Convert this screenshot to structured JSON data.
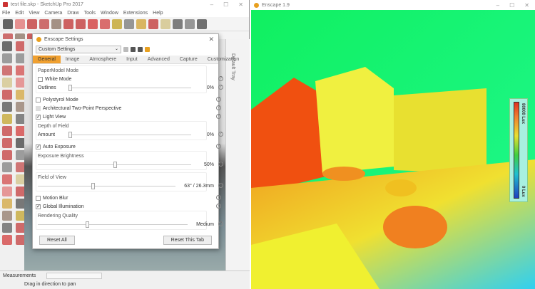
{
  "sketchup": {
    "title": "test file.skp - SketchUp Pro 2017",
    "menu": [
      "File",
      "Edit",
      "View",
      "Camera",
      "Draw",
      "Tools",
      "Window",
      "Extensions",
      "Help"
    ],
    "tray_label": "Default Tray",
    "status": {
      "measurements_label": "Measurements",
      "hint": "Drag in direction to pan"
    }
  },
  "dialog": {
    "title": "Enscape Settings",
    "preset": "Custom Settings",
    "tabs": [
      "General",
      "Image",
      "Atmosphere",
      "Input",
      "Advanced",
      "Capture",
      "Customization"
    ],
    "active_tab": "General",
    "papermodel": {
      "label": "PaperModel Mode",
      "white_mode": "White Mode",
      "white_mode_checked": false,
      "outlines_label": "Outlines",
      "outlines_value": "0%",
      "outlines_fraction": 0
    },
    "polystyrol": "Polystyrol Mode",
    "polystyrol_checked": false,
    "two_point": "Architectural Two-Point Perspective",
    "two_point_checked": false,
    "light_view": "Light View",
    "light_view_checked": true,
    "dof": {
      "label": "Depth of Field",
      "amount_label": "Amount",
      "amount_value": "0%",
      "amount_fraction": 0
    },
    "auto_exposure": "Auto Exposure",
    "auto_exposure_checked": true,
    "exposure": {
      "label": "Exposure Brightness",
      "value": "50%",
      "fraction": 0.5
    },
    "fov": {
      "label": "Field of View",
      "value": "63° / 26.3mm",
      "fraction": 0.4
    },
    "motion_blur": "Motion Blur",
    "motion_blur_checked": false,
    "gi": "Global Illumination",
    "gi_checked": true,
    "quality": {
      "label": "Rendering Quality",
      "value": "Medium",
      "fraction": 0.33
    },
    "reset_all": "Reset All",
    "reset_tab": "Reset This Tab"
  },
  "enscape": {
    "title": "Enscape 1.9",
    "legend": {
      "max": "80000 Lux",
      "min": "0 Lux"
    },
    "accent": "#f0a030"
  }
}
